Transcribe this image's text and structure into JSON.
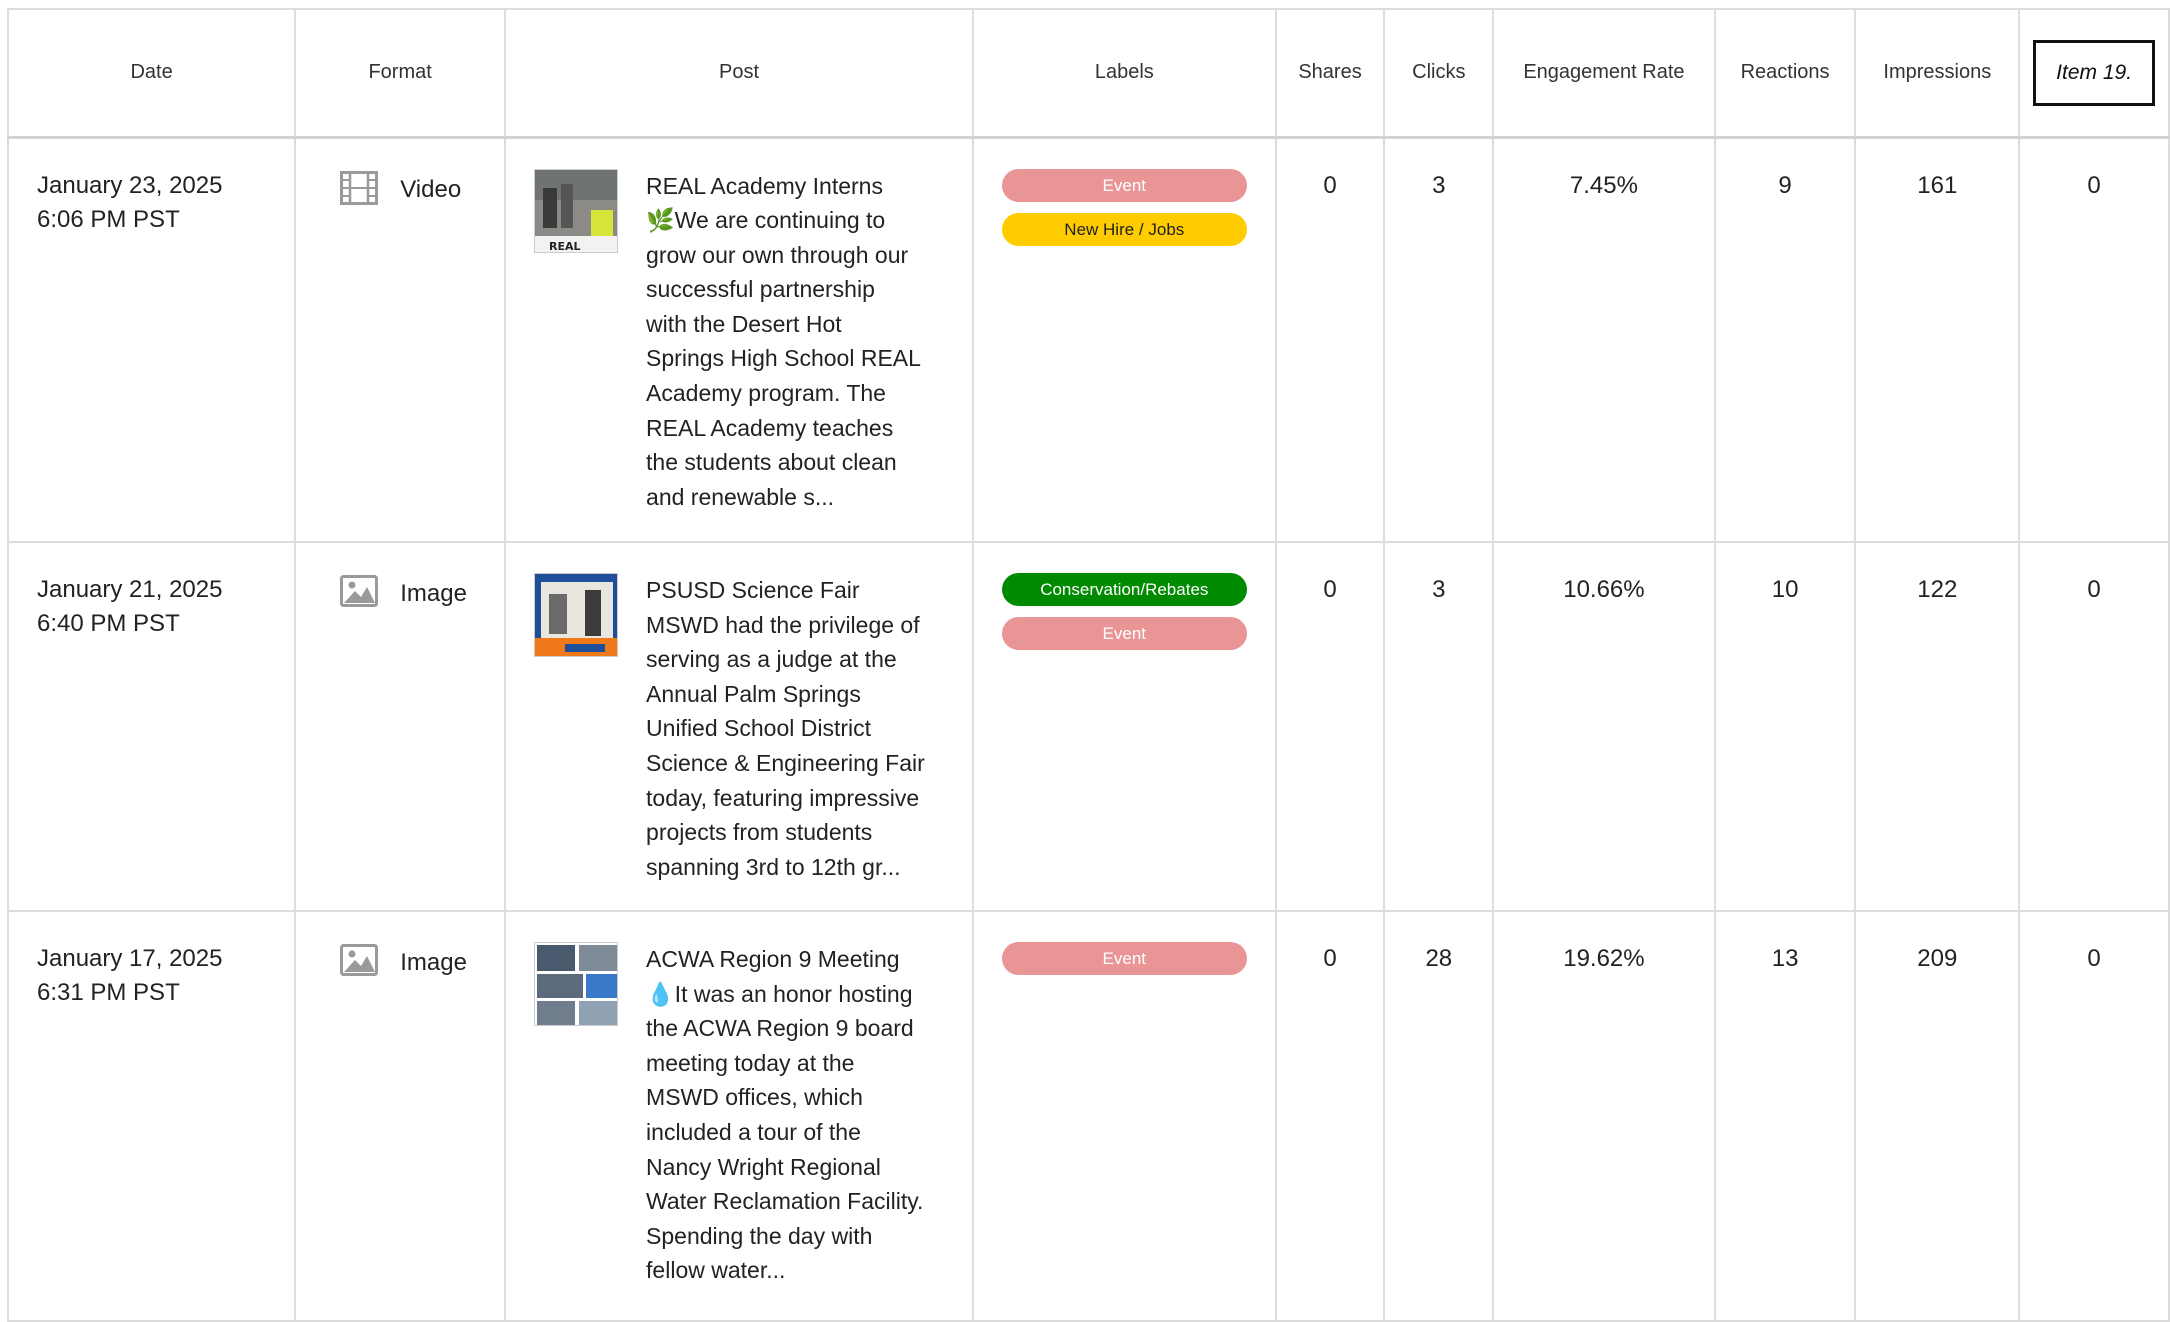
{
  "table": {
    "headers": {
      "date": "Date",
      "format": "Format",
      "post": "Post",
      "labels": "Labels",
      "shares": "Shares",
      "clicks": "Clicks",
      "engagement": "Engagement Rate",
      "reactions": "Reactions",
      "impressions": "Impressions",
      "item": "Item 19."
    },
    "rows": [
      {
        "date": "January 23, 2025",
        "time": "6:06 PM PST",
        "format": "Video",
        "format_icon": "film-icon",
        "post_lines": [
          "REAL Academy Interns",
          "🌿We are continuing to",
          "grow our own through our",
          "successful partnership",
          "with the Desert Hot",
          "Springs High School REAL",
          "Academy program. The",
          "REAL Academy teaches",
          "the students about clean",
          "and renewable s..."
        ],
        "labels": [
          {
            "text": "Event",
            "bg": "#e99595",
            "fg": "#ffffff"
          },
          {
            "text": "New Hire / Jobs",
            "bg": "#ffcc00",
            "fg": "#222222"
          }
        ],
        "shares": "0",
        "clicks": "3",
        "engagement": "7.45%",
        "reactions": "9",
        "impressions": "161",
        "item": "0"
      },
      {
        "date": "January 21, 2025",
        "time": "6:40 PM PST",
        "format": "Image",
        "format_icon": "image-icon",
        "post_lines": [
          "PSUSD Science Fair",
          "MSWD had the privilege of",
          "serving as a judge at the",
          "Annual Palm Springs",
          "Unified School District",
          "Science & Engineering Fair",
          "today, featuring impressive",
          "projects from students",
          "spanning 3rd to 12th gr..."
        ],
        "labels": [
          {
            "text": "Conservation/Rebates",
            "bg": "#008a00",
            "fg": "#ffffff"
          },
          {
            "text": "Event",
            "bg": "#e99595",
            "fg": "#ffffff"
          }
        ],
        "shares": "0",
        "clicks": "3",
        "engagement": "10.66%",
        "reactions": "10",
        "impressions": "122",
        "item": "0"
      },
      {
        "date": "January 17, 2025",
        "time": "6:31 PM PST",
        "format": "Image",
        "format_icon": "image-icon",
        "post_lines": [
          "ACWA Region 9 Meeting",
          "💧It was an honor hosting",
          "the ACWA Region 9 board",
          "meeting today at the",
          "MSWD offices, which",
          "included a tour of the",
          "Nancy Wright Regional",
          "Water Reclamation Facility.",
          "Spending the day with",
          "fellow water..."
        ],
        "labels": [
          {
            "text": "Event",
            "bg": "#e99595",
            "fg": "#ffffff"
          }
        ],
        "shares": "0",
        "clicks": "28",
        "engagement": "19.62%",
        "reactions": "13",
        "impressions": "209",
        "item": "0"
      }
    ]
  }
}
